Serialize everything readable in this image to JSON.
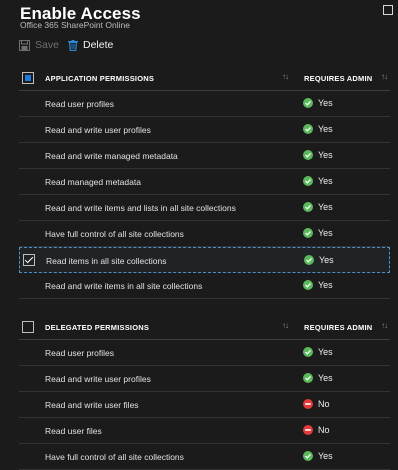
{
  "header": {
    "title": "Enable Access",
    "subtitle": "Office 365 SharePoint Online"
  },
  "toolbar": {
    "save_label": "Save",
    "delete_label": "Delete"
  },
  "colors": {
    "yes": "#5cb85c",
    "no": "#e03a3a",
    "accent": "#1e7be0"
  },
  "application": {
    "header": "APPLICATION PERMISSIONS",
    "admin_header": "REQUIRES ADMIN",
    "rows": [
      {
        "label": "Read user profiles",
        "admin": "Yes"
      },
      {
        "label": "Read and write user profiles",
        "admin": "Yes"
      },
      {
        "label": "Read and write managed metadata",
        "admin": "Yes"
      },
      {
        "label": "Read managed metadata",
        "admin": "Yes"
      },
      {
        "label": "Read and write items and lists in all site collections",
        "admin": "Yes"
      },
      {
        "label": "Have full control of all site collections",
        "admin": "Yes"
      },
      {
        "label": "Read items in all site collections",
        "admin": "Yes"
      },
      {
        "label": "Read and write items in all site collections",
        "admin": "Yes"
      }
    ]
  },
  "delegated": {
    "header": "DELEGATED PERMISSIONS",
    "admin_header": "REQUIRES ADMIN",
    "rows": [
      {
        "label": "Read user profiles",
        "admin": "Yes"
      },
      {
        "label": "Read and write user profiles",
        "admin": "Yes"
      },
      {
        "label": "Read and write user files",
        "admin": "No"
      },
      {
        "label": "Read user files",
        "admin": "No"
      },
      {
        "label": "Have full control of all site collections",
        "admin": "Yes"
      }
    ]
  }
}
